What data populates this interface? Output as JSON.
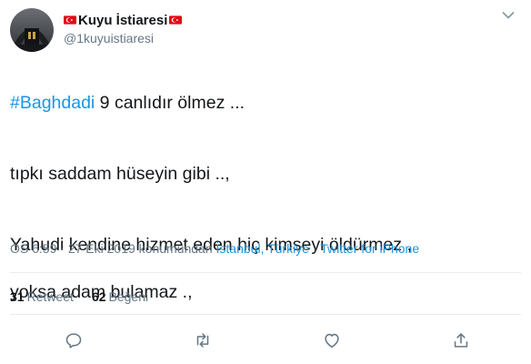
{
  "author": {
    "display_name": "Kuyu İstiaresi",
    "handle": "@1kuyuistiaresi"
  },
  "tweet": {
    "hashtag": "#Baghdadi",
    "line1_rest": " 9 canlıdır ölmez ...",
    "line2": "tıpkı saddam hüseyin gibi ..,",
    "line3": "Yahudi kendine hizmet eden hiç kimseyi öldürmez ,",
    "line4": "yoksa adam bulamaz .,"
  },
  "meta": {
    "time": "ÖS 6:59",
    "sep1": " · ",
    "date": "27 Eki 2019",
    "location_prefix": " konumundan ",
    "location": "İstanbul, Türkiye",
    "sep2": " · ",
    "source": "Twitter for iPhone"
  },
  "stats": {
    "retweets_count": "31",
    "retweets_label": "Retweet",
    "likes_count": "62",
    "likes_label": "Beğeni"
  },
  "colors": {
    "link": "#1b95e0",
    "secondary": "#657786",
    "flag_red": "#e30a17"
  },
  "icons": [
    "turkey-flag-icon",
    "chevron-down-icon",
    "reply-icon",
    "retweet-icon",
    "like-icon",
    "share-icon"
  ]
}
